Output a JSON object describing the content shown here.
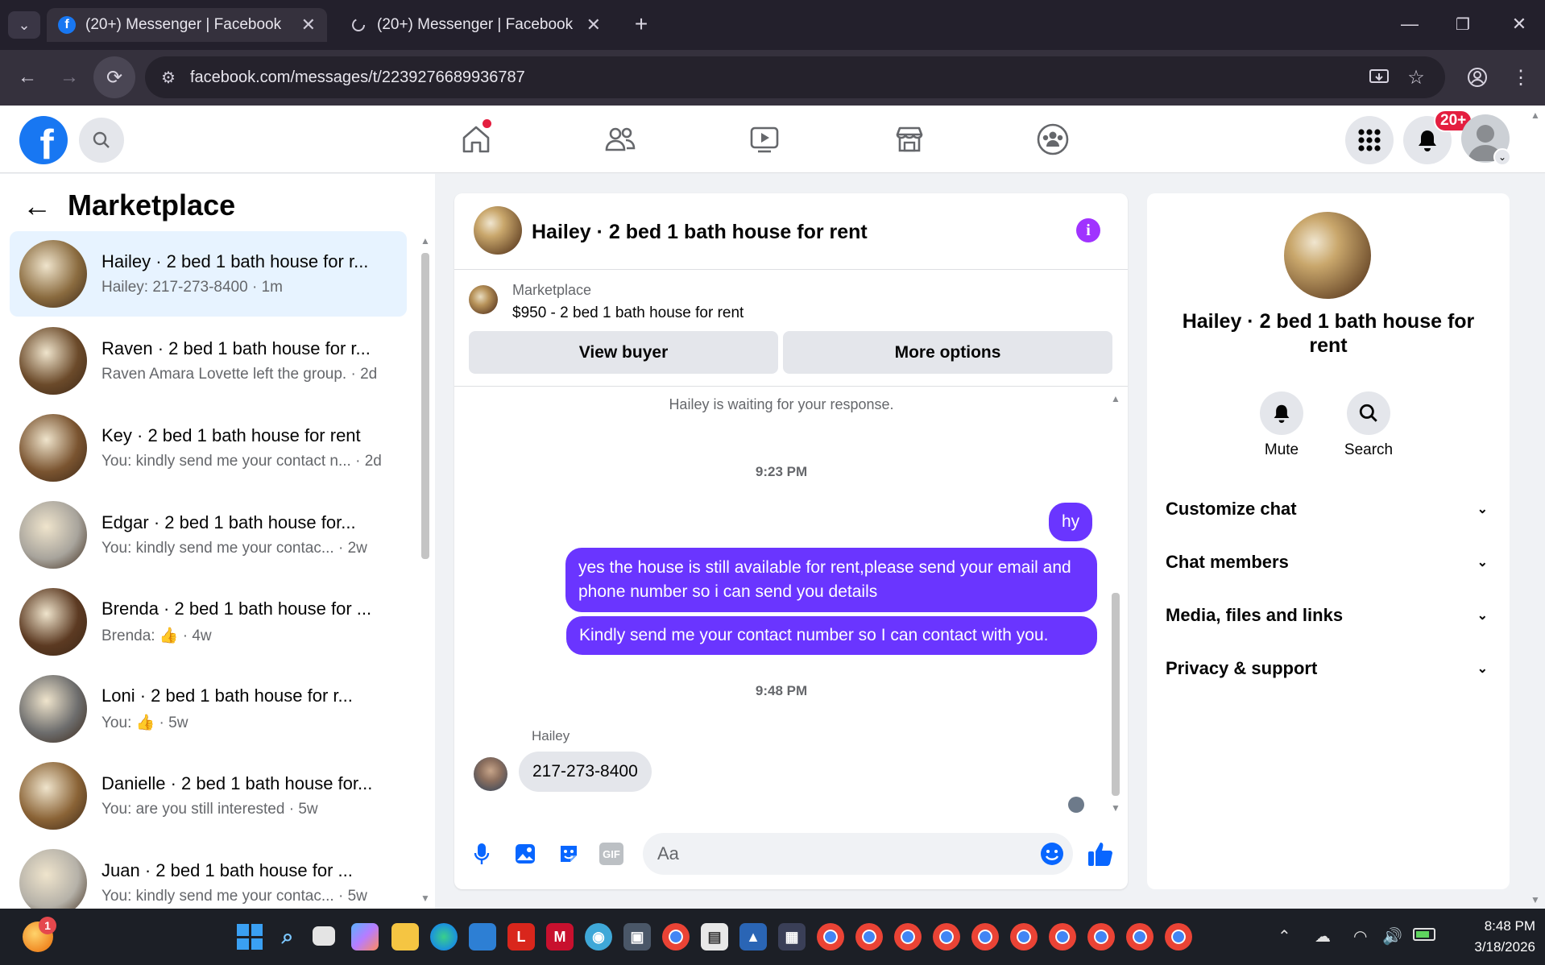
{
  "browser": {
    "tabs": [
      {
        "title": "(20+) Messenger | Facebook"
      },
      {
        "title": "(20+) Messenger | Facebook"
      }
    ],
    "url": "facebook.com/messages/t/2239276689936787"
  },
  "header": {
    "notification_badge": "20+"
  },
  "sidebar": {
    "title": "Marketplace",
    "conversations": [
      {
        "name": "Hailey · 2 bed 1 bath house for r...",
        "preview": "Hailey: 217-273-8400 · 1m",
        "thumb_color": "#8a6b3f"
      },
      {
        "name": "Raven · 2 bed 1 bath house for r...",
        "preview": "Raven Amara Lovette left the group. · 2d",
        "thumb_color": "#6b4a2a"
      },
      {
        "name": "Key · 2 bed 1 bath house for rent",
        "preview": "You: kindly send me your contact n... · 2d",
        "thumb_color": "#7a5430"
      },
      {
        "name": "Edgar · 2 bed 1 bath house for...",
        "preview": "You: kindly send me your contac... · 2w",
        "thumb_color": "#a8a49c"
      },
      {
        "name": "Brenda · 2 bed 1 bath house for ...",
        "preview": "Brenda: 👍 · 4w",
        "thumb_color": "#5c3a22"
      },
      {
        "name": "Loni · 2 bed 1 bath house for r...",
        "preview": "You: 👍 · 5w",
        "thumb_color": "#6d6d6d"
      },
      {
        "name": "Danielle · 2 bed 1 bath house for...",
        "preview": "You: are you still interested · 5w",
        "thumb_color": "#8a6336"
      },
      {
        "name": "Juan · 2 bed 1 bath house for ...",
        "preview": "You: kindly send me your contac... · 5w",
        "thumb_color": "#b5b1a8"
      }
    ]
  },
  "chat": {
    "title": "Hailey · 2 bed 1 bath house for rent",
    "listing_label": "Marketplace",
    "listing_title": "$950 - 2 bed 1 bath house for rent",
    "view_buyer": "View buyer",
    "more_options": "More options",
    "waiting": "Hailey is waiting for your response.",
    "time1": "9:23 PM",
    "msg_hy": "hy",
    "msg_long": "yes the house is still available for rent,please send your email and phone number so i can send you details",
    "msg_kindly": "Kindly send me your contact number so I can contact with you.",
    "time2": "9:48 PM",
    "sender": "Hailey",
    "msg_in": "217-273-8400",
    "input_placeholder": "Aa"
  },
  "details": {
    "title": "Hailey · 2 bed 1 bath house for rent",
    "mute": "Mute",
    "search": "Search",
    "sections": [
      "Customize chat",
      "Chat members",
      "Media, files and links",
      "Privacy & support"
    ]
  },
  "taskbar": {
    "time": "8:48 PM",
    "date": "3/18/2026",
    "weather_badge": "1"
  },
  "colors": {
    "fb_blue": "#1877f2",
    "accent_purple": "#6a35ff",
    "selected_row": "#e7f3ff"
  }
}
